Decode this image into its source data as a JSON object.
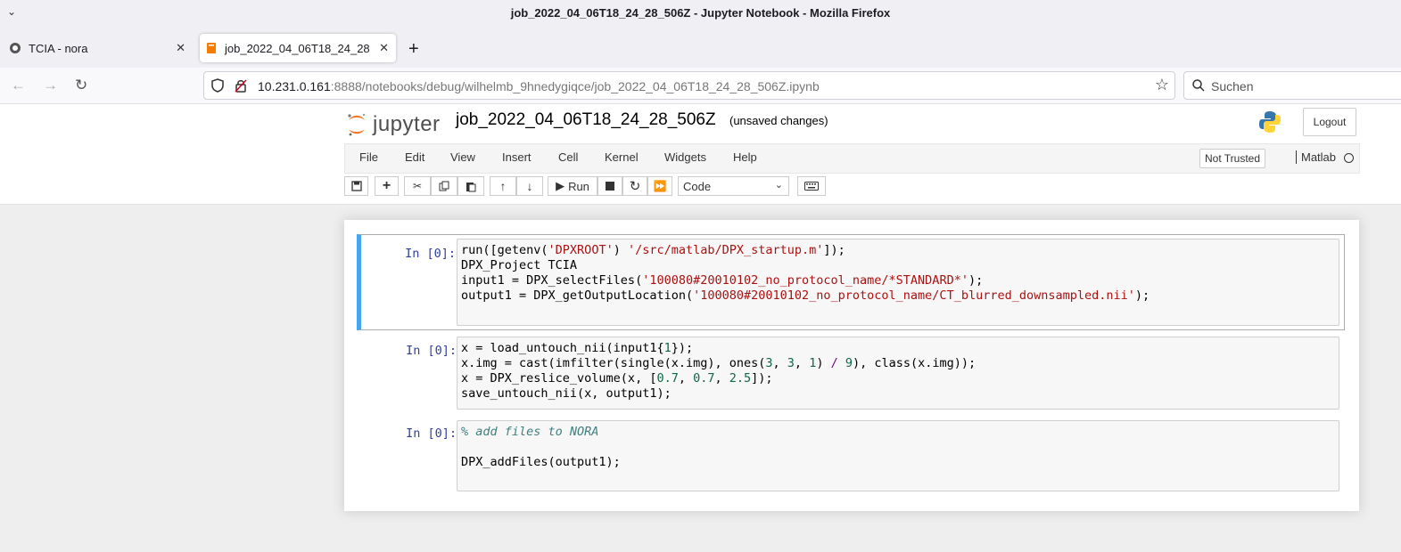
{
  "window": {
    "title": "job_2022_04_06T18_24_28_506Z - Jupyter Notebook - Mozilla Firefox"
  },
  "tabs": [
    {
      "label": "TCIA - nora"
    },
    {
      "label": "job_2022_04_06T18_24_28"
    }
  ],
  "navbar": {
    "url_host": "10.231.0.161",
    "url_rest": ":8888/notebooks/debug/wilhelmb_9hnedygiqce/job_2022_04_06T18_24_28_506Z.ipynb",
    "search_placeholder": "Suchen"
  },
  "jupyter": {
    "logo_text": "jupyter",
    "notebook_name": "job_2022_04_06T18_24_28_506Z",
    "save_status": "(unsaved changes)",
    "logout_label": "Logout",
    "menus": [
      "File",
      "Edit",
      "View",
      "Insert",
      "Cell",
      "Kernel",
      "Widgets",
      "Help"
    ],
    "trusted_label": "Not Trusted",
    "kernel_name": "Matlab",
    "run_label": "Run",
    "cell_type": "Code"
  },
  "cells": [
    {
      "prompt": "In [0]:"
    },
    {
      "prompt": "In [0]:"
    },
    {
      "prompt": "In [0]:"
    }
  ],
  "colors": {
    "selected_cell_border": "#42a5f5",
    "prompt": "#303f9f",
    "string": "#aa1111",
    "number": "#116644",
    "comment": "#408080"
  }
}
